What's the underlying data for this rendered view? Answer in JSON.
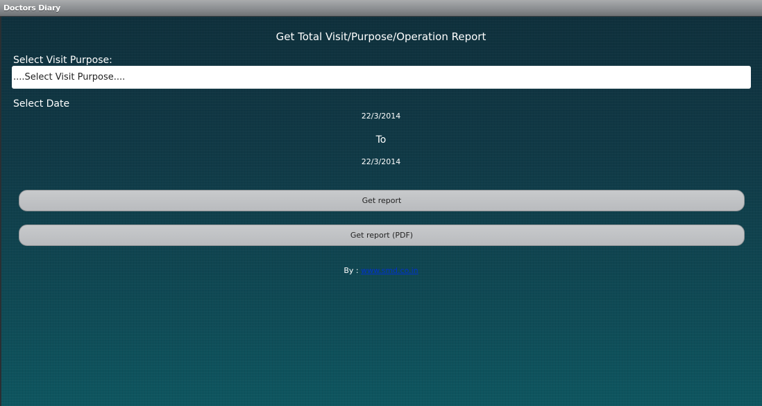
{
  "window": {
    "title": "Doctors Diary"
  },
  "page": {
    "heading": "Get Total Visit/Purpose/Operation Report"
  },
  "visit_purpose": {
    "label": "Select Visit Purpose:",
    "selected_value": "....Select Visit Purpose...."
  },
  "date_range": {
    "label": "Select Date",
    "from": "22/3/2014",
    "separator": "To",
    "to": "22/3/2014"
  },
  "buttons": {
    "get_report": "Get report",
    "get_report_pdf": "Get report (PDF)"
  },
  "footer": {
    "by_label": "By : ",
    "link_text": "www.smd.co.in"
  },
  "colors": {
    "background_top": "#0f2f3b",
    "background_bottom": "#0e5660",
    "button": "#c0c2c5",
    "link": "#0033cc"
  }
}
